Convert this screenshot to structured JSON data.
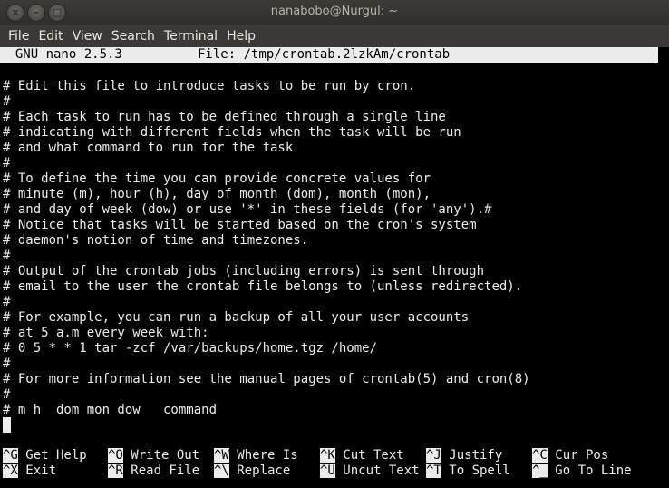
{
  "window": {
    "title": "nanabobo@Nurgul: ~",
    "buttons": [
      "×",
      "–",
      "□"
    ]
  },
  "menu": [
    "File",
    "Edit",
    "View",
    "Search",
    "Terminal",
    "Help"
  ],
  "nano": {
    "version": "  GNU nano 2.5.3",
    "file": "File: /tmp/crontab.2lzkAm/crontab"
  },
  "lines": [
    "# Edit this file to introduce tasks to be run by cron.",
    "#",
    "# Each task to run has to be defined through a single line",
    "# indicating with different fields when the task will be run",
    "# and what command to run for the task",
    "#",
    "# To define the time you can provide concrete values for",
    "# minute (m), hour (h), day of month (dom), month (mon),",
    "# and day of week (dow) or use '*' in these fields (for 'any').#",
    "# Notice that tasks will be started based on the cron's system",
    "# daemon's notion of time and timezones.",
    "#",
    "# Output of the crontab jobs (including errors) is sent through",
    "# email to the user the crontab file belongs to (unless redirected).",
    "#",
    "# For example, you can run a backup of all your user accounts",
    "# at 5 a.m every week with:",
    "# 0 5 * * 1 tar -zcf /var/backups/home.tgz /home/",
    "#",
    "# For more information see the manual pages of crontab(5) and cron(8)",
    "#",
    "# m h  dom mon dow   command"
  ],
  "shortcuts": {
    "row1": [
      {
        "key": "^G",
        "label": " Get Help"
      },
      {
        "key": "^O",
        "label": " Write Out"
      },
      {
        "key": "^W",
        "label": " Where Is"
      },
      {
        "key": "^K",
        "label": " Cut Text"
      },
      {
        "key": "^J",
        "label": " Justify"
      },
      {
        "key": "^C",
        "label": " Cur Pos"
      }
    ],
    "row2": [
      {
        "key": "^X",
        "label": " Exit"
      },
      {
        "key": "^R",
        "label": " Read File"
      },
      {
        "key": "^\\",
        "label": " Replace"
      },
      {
        "key": "^U",
        "label": " Uncut Text"
      },
      {
        "key": "^T",
        "label": " To Spell"
      },
      {
        "key": "^_",
        "label": " Go To Line"
      }
    ]
  }
}
